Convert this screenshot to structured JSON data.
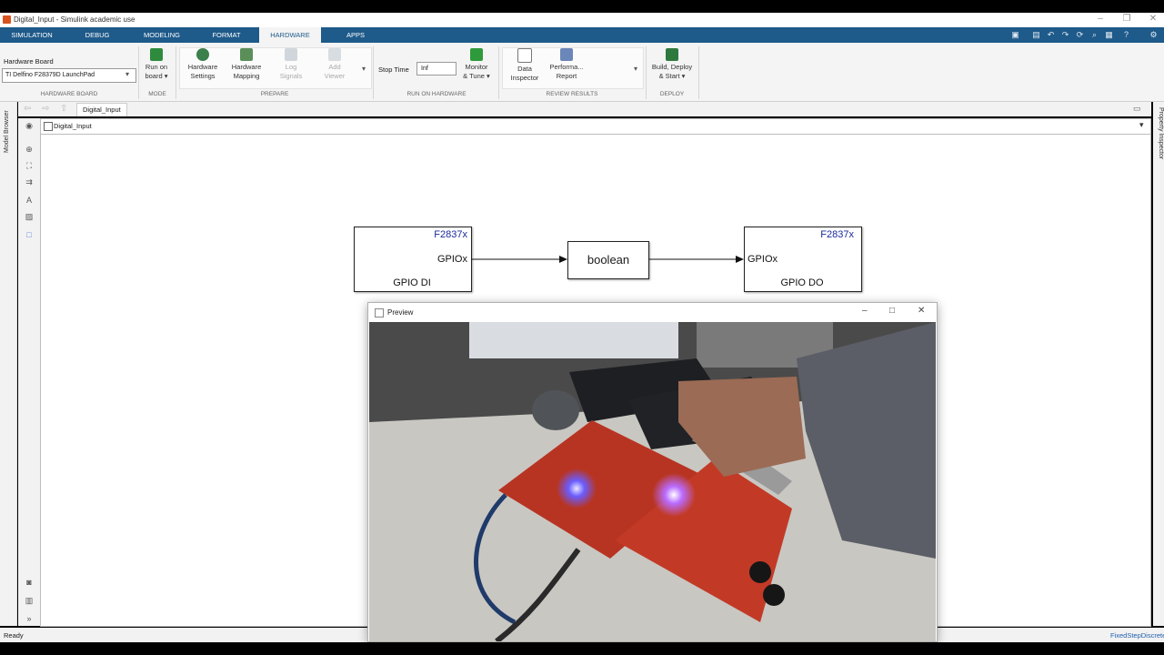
{
  "window": {
    "title": "Digital_Input - Simulink academic use"
  },
  "tabs": [
    "SIMULATION",
    "DEBUG",
    "MODELING",
    "FORMAT",
    "HARDWARE",
    "APPS"
  ],
  "active_tab": "HARDWARE",
  "toolstrip": {
    "hardware_board": {
      "label": "Hardware Board",
      "value": "TI Delfino F28379D LaunchPad",
      "section": "HARDWARE BOARD"
    },
    "mode": {
      "run_on_board": "Run on\nboard",
      "section": "MODE"
    },
    "prepare": {
      "hardware_settings": "Hardware\nSettings",
      "hardware_mapping": "Hardware\nMapping",
      "log_signals": "Log\nSignals",
      "add_viewer": "Add\nViewer",
      "section": "PREPARE"
    },
    "run_on_hardware": {
      "stop_time_label": "Stop Time",
      "stop_time_value": "Inf",
      "monitor_tune": "Monitor\n& Tune",
      "section": "RUN ON HARDWARE"
    },
    "review_results": {
      "data_inspector": "Data\nInspector",
      "performance_report": "Performa...\nReport",
      "section": "REVIEW RESULTS"
    },
    "deploy": {
      "build_deploy_start": "Build, Deploy\n& Start",
      "section": "DEPLOY"
    }
  },
  "editor": {
    "tab": "Digital_Input",
    "address": "Digital_Input",
    "left_panel": "Model Browser",
    "right_panel": "Property Inspector"
  },
  "diagram": {
    "gpio_di": {
      "header": "F2837x",
      "port": "GPIOx",
      "name": "GPIO DI"
    },
    "convert": {
      "label": "boolean"
    },
    "gpio_do": {
      "header": "F2837x",
      "port": "GPIOx",
      "name": "GPIO DO"
    }
  },
  "preview": {
    "title": "Preview"
  },
  "status": {
    "left": "Ready",
    "right": "FixedStepDiscrete"
  },
  "colors": {
    "tabstrip": "#1e5a8a",
    "block_header": "#1a2a9a"
  }
}
